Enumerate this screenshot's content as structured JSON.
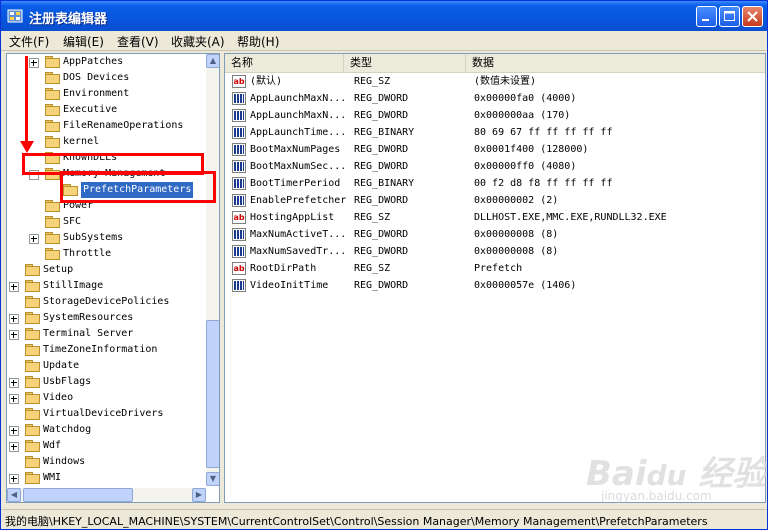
{
  "window": {
    "title": "注册表编辑器",
    "controls": {
      "minimize": "minimize-icon",
      "maximize": "maximize-icon",
      "close": "close-icon"
    }
  },
  "menu": [
    "文件(F)",
    "编辑(E)",
    "查看(V)",
    "收藏夹(A)",
    "帮助(H)"
  ],
  "tree": {
    "items": [
      {
        "label": "AppPatches",
        "expander": "plus"
      },
      {
        "label": "DOS Devices",
        "expander": "none"
      },
      {
        "label": "Environment",
        "expander": "none"
      },
      {
        "label": "Executive",
        "expander": "none"
      },
      {
        "label": "FileRenameOperations",
        "expander": "none"
      },
      {
        "label": "kernel",
        "expander": "none"
      },
      {
        "label": "KnownDLLs",
        "expander": "none"
      },
      {
        "label": "Memory Management",
        "expander": "minus"
      },
      {
        "label": "PrefetchParameters",
        "expander": "none",
        "selected": true
      },
      {
        "label": "Power",
        "expander": "none"
      },
      {
        "label": "SFC",
        "expander": "none"
      },
      {
        "label": "SubSystems",
        "expander": "plus"
      },
      {
        "label": "Throttle",
        "expander": "none"
      },
      {
        "label": "Setup",
        "expander": "none"
      },
      {
        "label": "StillImage",
        "expander": "plus"
      },
      {
        "label": "StorageDevicePolicies",
        "expander": "none"
      },
      {
        "label": "SystemResources",
        "expander": "plus"
      },
      {
        "label": "Terminal Server",
        "expander": "plus"
      },
      {
        "label": "TimeZoneInformation",
        "expander": "none"
      },
      {
        "label": "Update",
        "expander": "none"
      },
      {
        "label": "UsbFlags",
        "expander": "plus"
      },
      {
        "label": "Video",
        "expander": "plus"
      },
      {
        "label": "VirtualDeviceDrivers",
        "expander": "none"
      },
      {
        "label": "Watchdog",
        "expander": "plus"
      },
      {
        "label": "Wdf",
        "expander": "plus"
      },
      {
        "label": "Windows",
        "expander": "none"
      },
      {
        "label": "WMI",
        "expander": "plus"
      }
    ]
  },
  "list": {
    "columns": [
      "名称",
      "类型",
      "数据"
    ],
    "rows": [
      {
        "icon": "string-value-icon",
        "name": "(默认)",
        "type": "REG_SZ",
        "data": "(数值未设置)"
      },
      {
        "icon": "binary-value-icon",
        "name": "AppLaunchMaxN...",
        "type": "REG_DWORD",
        "data": "0x00000fa0 (4000)"
      },
      {
        "icon": "binary-value-icon",
        "name": "AppLaunchMaxN...",
        "type": "REG_DWORD",
        "data": "0x000000aa (170)"
      },
      {
        "icon": "binary-value-icon",
        "name": "AppLaunchTime...",
        "type": "REG_BINARY",
        "data": "80 69 67 ff ff ff ff ff"
      },
      {
        "icon": "binary-value-icon",
        "name": "BootMaxNumPages",
        "type": "REG_DWORD",
        "data": "0x0001f400 (128000)"
      },
      {
        "icon": "binary-value-icon",
        "name": "BootMaxNumSec...",
        "type": "REG_DWORD",
        "data": "0x00000ff0 (4080)"
      },
      {
        "icon": "binary-value-icon",
        "name": "BootTimerPeriod",
        "type": "REG_BINARY",
        "data": "00 f2 d8 f8 ff ff ff ff"
      },
      {
        "icon": "binary-value-icon",
        "name": "EnablePrefetcher",
        "type": "REG_DWORD",
        "data": "0x00000002 (2)"
      },
      {
        "icon": "string-value-icon",
        "name": "HostingAppList",
        "type": "REG_SZ",
        "data": "DLLHOST.EXE,MMC.EXE,RUNDLL32.EXE"
      },
      {
        "icon": "binary-value-icon",
        "name": "MaxNumActiveT...",
        "type": "REG_DWORD",
        "data": "0x00000008 (8)"
      },
      {
        "icon": "binary-value-icon",
        "name": "MaxNumSavedTr...",
        "type": "REG_DWORD",
        "data": "0x00000008 (8)"
      },
      {
        "icon": "string-value-icon",
        "name": "RootDirPath",
        "type": "REG_SZ",
        "data": "Prefetch"
      },
      {
        "icon": "binary-value-icon",
        "name": "VideoInitTime",
        "type": "REG_DWORD",
        "data": "0x0000057e (1406)"
      }
    ]
  },
  "status": "我的电脑\\HKEY_LOCAL_MACHINE\\SYSTEM\\CurrentControlSet\\Control\\Session Manager\\Memory Management\\PrefetchParameters",
  "annotation": {
    "color": "#ff0000"
  },
  "watermark": {
    "logo": "Baidu 经验",
    "url": "jingyan.baidu.com"
  }
}
